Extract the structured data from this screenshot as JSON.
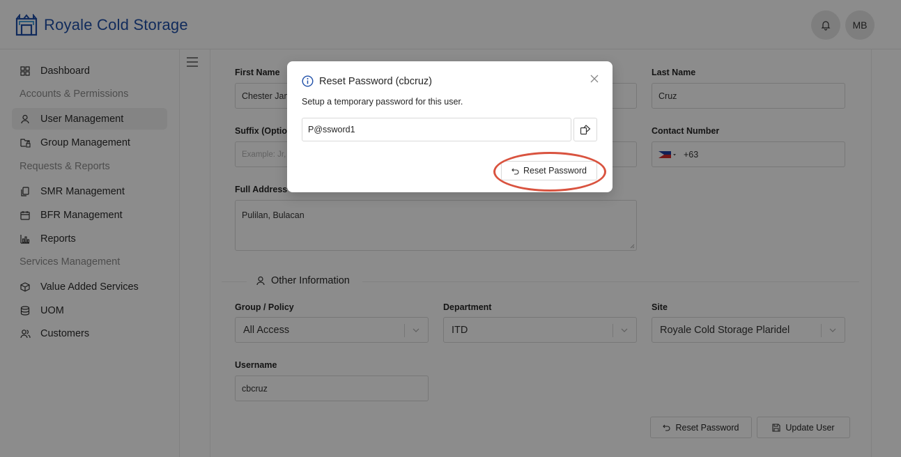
{
  "header": {
    "brand": "Royale Cold Storage",
    "user_initials": "MB"
  },
  "sidebar": {
    "items": [
      {
        "label": "Dashboard",
        "icon": "dashboard-icon"
      },
      {
        "group": "Accounts & Permissions"
      },
      {
        "label": "User Management",
        "icon": "user-icon",
        "active": true
      },
      {
        "label": "Group Management",
        "icon": "group-lock-icon"
      },
      {
        "group": "Requests & Reports"
      },
      {
        "label": "SMR Management",
        "icon": "copy-icon"
      },
      {
        "label": "BFR Management",
        "icon": "calendar-icon"
      },
      {
        "label": "Reports",
        "icon": "bar-chart-icon"
      },
      {
        "group": "Services Management"
      },
      {
        "label": "Value Added Services",
        "icon": "box-icon"
      },
      {
        "label": "UOM",
        "icon": "database-icon"
      },
      {
        "label": "Customers",
        "icon": "users-icon"
      }
    ]
  },
  "form": {
    "first_name_label": "First Name",
    "first_name_value": "Chester Jam",
    "last_name_label": "Last Name",
    "last_name_value": "Cruz",
    "suffix_label": "Suffix (Optio",
    "suffix_placeholder": "Example: Jr,",
    "contact_label": "Contact Number",
    "contact_value": "+63",
    "address_label": "Full Address",
    "address_value": "Pulilan, Bulacan",
    "other_info_title": "Other Information",
    "group_label": "Group / Policy",
    "group_value": "All Access",
    "department_label": "Department",
    "department_value": "ITD",
    "site_label": "Site",
    "site_value": "Royale Cold Storage Plaridel",
    "username_label": "Username",
    "username_value": "cbcruz",
    "reset_password_btn": "Reset Password",
    "update_user_btn": "Update User"
  },
  "modal": {
    "title": "Reset Password (cbcruz)",
    "description": "Setup a temporary password for this user.",
    "password_value": "P@ssword1",
    "reset_btn": "Reset Password"
  },
  "colors": {
    "brand": "#1f4fa8",
    "highlight": "#d9533f",
    "info": "#1f4fa8"
  }
}
